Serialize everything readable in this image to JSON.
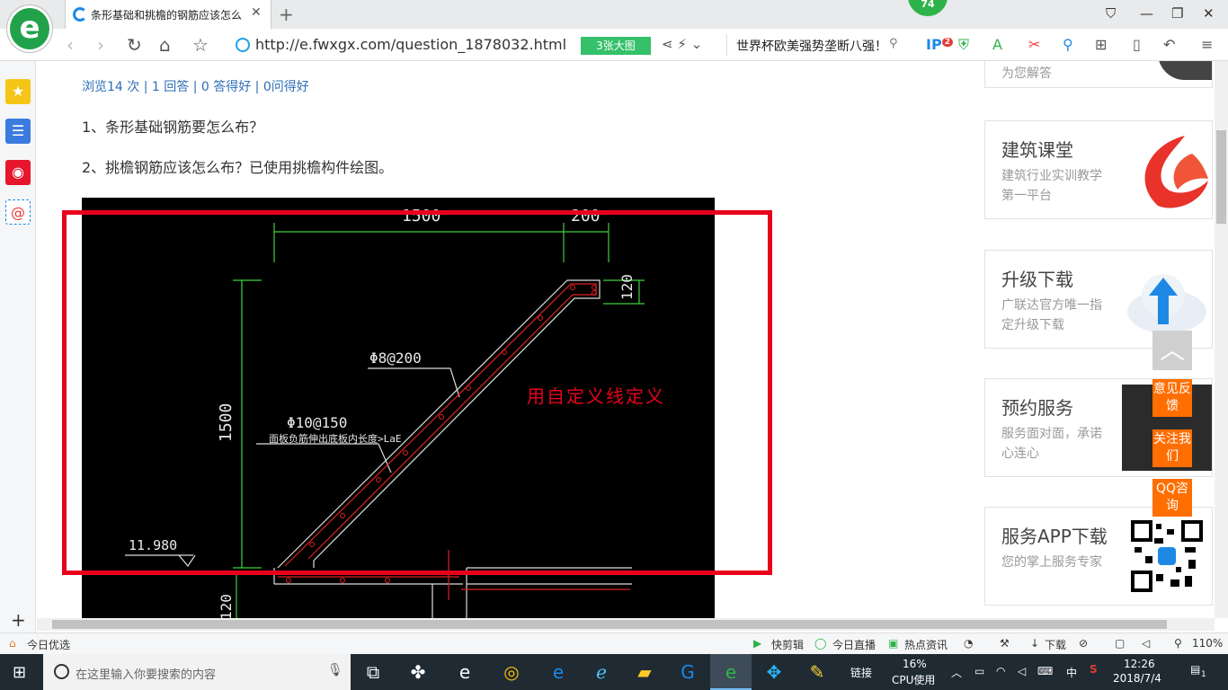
{
  "browser": {
    "tab_title": "条形基础和挑檐的钢筋应该怎么设",
    "url": "http://e.fwxgx.com/question_1878032.html",
    "image_button": "3张大图",
    "search_text": "世界杯欧美强势垄断八强！",
    "badge": "74",
    "ip_badge": "2"
  },
  "page": {
    "stats": "浏览14 次 | 1 回答 | 0 答得好 | 0问得好",
    "q1": "1、条形基础钢筋要怎么布？",
    "q2": "2、挑檐钢筋应该怎么布？已使用挑檐构件绘图。",
    "annotation": "用自定义线定义"
  },
  "cad": {
    "dim_1500_top": "1500",
    "dim_200": "200",
    "dim_120_right": "120",
    "dim_1500_left": "1500",
    "dim_120_bottom": "120",
    "rebar_1": "Φ8@200",
    "rebar_2": "Φ10@150",
    "rebar_note": "面板负筋伸出底板内长度>LaE",
    "elevation": "11.980"
  },
  "sidebar_right": {
    "top_card_desc": "为您解答",
    "cards": [
      {
        "title": "建筑课堂",
        "desc": "建筑行业实训教学第一平台"
      },
      {
        "title": "升级下载",
        "desc": "广联达官方唯一指定升级下载"
      },
      {
        "title": "预约服务",
        "desc": "服务面对面，承诺心连心"
      },
      {
        "title": "服务APP下载",
        "desc": "您的掌上服务专家"
      }
    ],
    "float_buttons": [
      "意见反馈",
      "关注我们",
      "QQ咨询"
    ]
  },
  "statusbar": {
    "left": "今日优选",
    "items": [
      "快剪辑",
      "今日直播",
      "热点资讯",
      "下载"
    ],
    "zoom": "110%"
  },
  "taskbar": {
    "search_placeholder": "在这里输入你要搜索的内容",
    "links": "链接",
    "cpu_pct": "16%",
    "cpu_label": "CPU使用",
    "ime": "中",
    "time": "12:26",
    "date": "2018/7/4",
    "notif": "1"
  },
  "colors": {
    "accent_green": "#21a24a",
    "link_blue": "#2e6eb8",
    "annotation_red": "#e8001c",
    "float_orange": "#ff6e00",
    "taskbar": "#1f2a33"
  }
}
